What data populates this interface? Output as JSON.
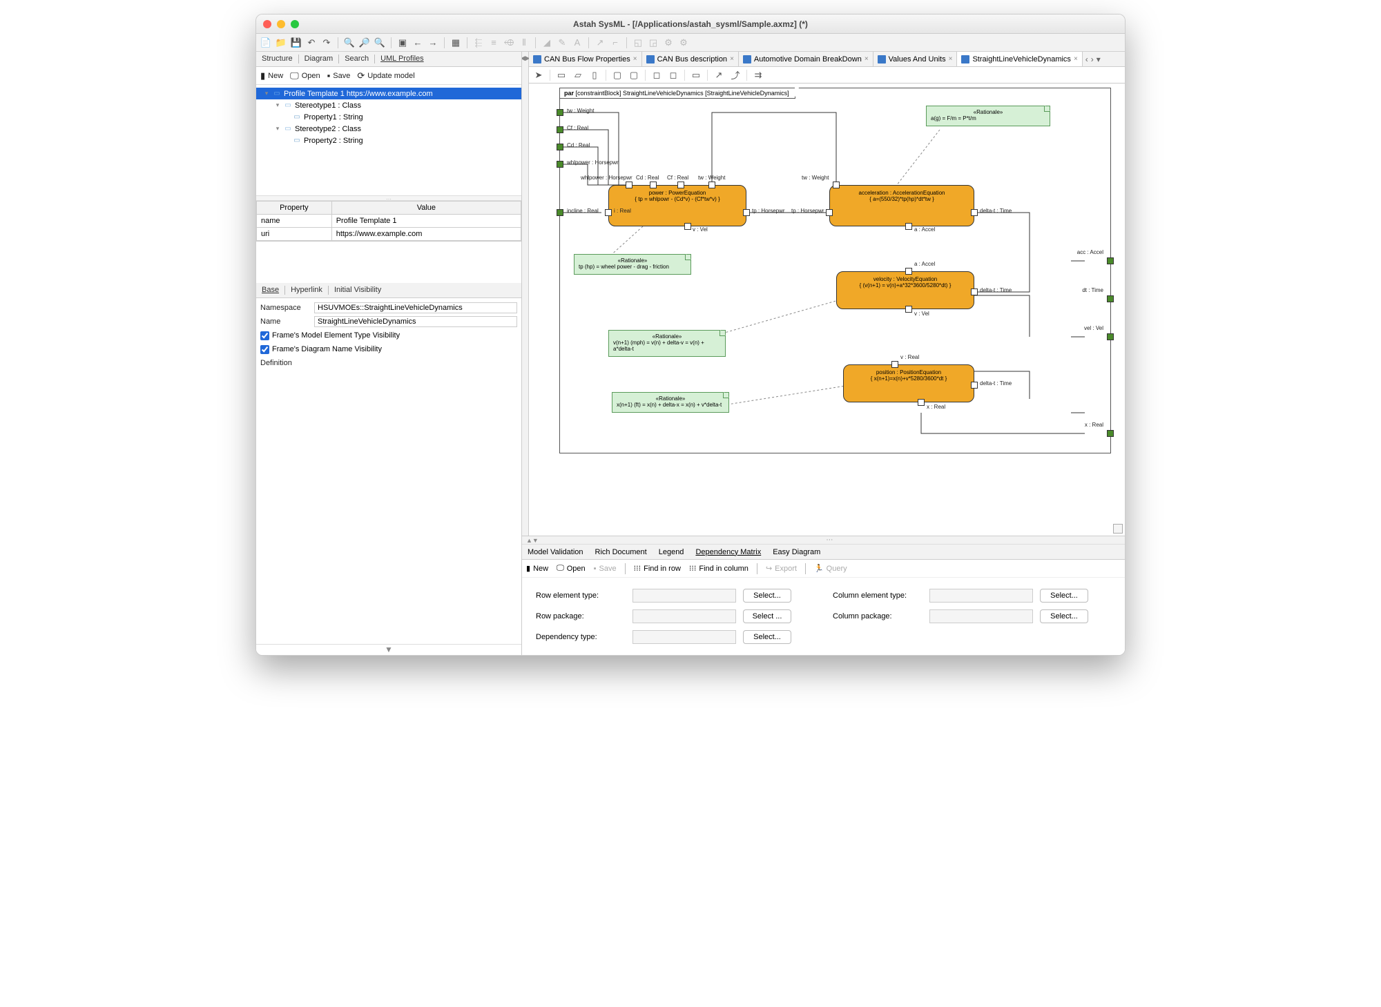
{
  "window": {
    "title": "Astah SysML - [/Applications/astah_sysml/Sample.axmz] (*)"
  },
  "left": {
    "tabs": [
      "Structure",
      "Diagram",
      "Search",
      "UML Profiles"
    ],
    "toolbar": {
      "new": "New",
      "open": "Open",
      "save": "Save",
      "update": "Update model"
    },
    "tree": {
      "root": "Profile Template 1 https://www.example.com",
      "n1": "Stereotype1 : Class",
      "n1p": "Property1 : String",
      "n2": "Stereotype2 : Class",
      "n2p": "Property2 : String"
    },
    "propTable": {
      "h1": "Property",
      "h2": "Value",
      "r1k": "name",
      "r1v": "Profile Template 1",
      "r2k": "uri",
      "r2v": "https://www.example.com"
    },
    "tabs2": [
      "Base",
      "Hyperlink",
      "Initial Visibility"
    ],
    "details": {
      "nsLabel": "Namespace",
      "ns": "HSUVMOEs::StraightLineVehicleDynamics",
      "nameLabel": "Name",
      "name": "StraightLineVehicleDynamics",
      "chk1": "Frame's Model Element Type Visibility",
      "chk2": "Frame's Diagram Name Visibility",
      "defLabel": "Definition"
    }
  },
  "editor": {
    "tabs": [
      "CAN Bus Flow Properties",
      "CAN Bus description",
      "Automotive Domain BreakDown",
      "Values And Units",
      "StraightLineVehicleDynamics"
    ],
    "frameLabel": "par [constraintBlock] StraightLineVehicleDynamics [StraightLineVehicleDynamics]",
    "blocks": {
      "power": {
        "name": "power : PowerEquation",
        "eq": "{ tp = whlpowr - (Cd*v) - (Cf*tw*v) }"
      },
      "accel": {
        "name": "acceleration : AccelerationEquation",
        "eq": "{ a=(550/32)*tp(hp)*dt*tw }"
      },
      "vel": {
        "name": "velocity : VelocityEquation",
        "eq": "{ (v(n+1) = v(n)+a*32*3600/5280*dt) }"
      },
      "pos": {
        "name": "position : PositionEquation",
        "eq": "{ x(n+1)=x(n)+v*5280/3600*dt }"
      }
    },
    "notes": {
      "n1t": "«Rationale»",
      "n1": "a(g) = F/m = P*t/m",
      "n2t": "«Rationale»",
      "n2": "tp (hp) = wheel power - drag - friction",
      "n3t": "«Rationale»",
      "n3": "v(n+1) (mph) = v(n) + delta-v = v(n) + a*delta-t",
      "n4t": "«Rationale»",
      "n4": "x(n+1) (ft) = x(n) + delta-x = x(n) + v*delta-t"
    },
    "ports": {
      "tw": "tw : Weight",
      "cf": "Cf : Real",
      "cd": "Cd : Real",
      "whl": "whlpower : Horsepwr",
      "whl2": "whlpower : Horsepwr",
      "cd2": "Cd : Real",
      "cf2": "Cf : Real",
      "tw2": "tw : Weight",
      "incline": "incline : Real",
      "i": "i : Real",
      "tp": "tp : Horsepwr",
      "tp2": "tp : Horsepwr",
      "tw3": "tw : Weight",
      "dt": "delta-t : Time",
      "v": "v : Vel",
      "a": "a : Accel",
      "a2": "a : Accel",
      "dt2": "delta-t : Time",
      "v2": "v : Vel",
      "v3": "v : Real",
      "dt3": "delta-t : Time",
      "x": "x : Real",
      "acc": "acc : Accel",
      "dtR": "dt : Time",
      "velR": "vel : Vel",
      "xR": "x : Real"
    }
  },
  "bottom": {
    "tabs": [
      "Model Validation",
      "Rich Document",
      "Legend",
      "Dependency Matrix",
      "Easy Diagram"
    ],
    "toolbar": {
      "new": "New",
      "open": "Open",
      "save": "Save",
      "findRow": "Find in row",
      "findCol": "Find in column",
      "export": "Export",
      "query": "Query"
    },
    "form": {
      "rowElem": "Row element type:",
      "rowPkg": "Row package:",
      "depType": "Dependency type:",
      "colElem": "Column element type:",
      "colPkg": "Column package:",
      "select": "Select...",
      "select2": "Select ..."
    }
  }
}
